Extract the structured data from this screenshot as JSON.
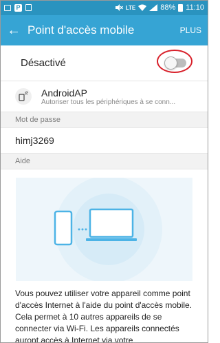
{
  "status_bar": {
    "signal_label": "LTE",
    "battery": "88%",
    "time": "11:10"
  },
  "app_bar": {
    "title": "Point d'accès mobile",
    "more_label": "PLUS"
  },
  "hotspot_toggle": {
    "label": "Désactivé",
    "enabled": false
  },
  "network": {
    "name": "AndroidAP",
    "subtitle": "Autoriser tous les périphériques à se conn..."
  },
  "password_section": {
    "header": "Mot de passe",
    "value": "himj3269"
  },
  "help_section": {
    "header": "Aide",
    "text": "Vous pouvez utiliser votre appareil comme point d'accès Internet à l'aide du point d'accès mobile. Cela permet à 10 autres appareils de se connecter via Wi-Fi. Les appareils connectés auront accès à Internet via votre"
  },
  "colors": {
    "status_bar": "#2a93bf",
    "app_bar": "#36a4d4",
    "device_blue": "#4cb3e6",
    "highlight": "#d8202a"
  }
}
